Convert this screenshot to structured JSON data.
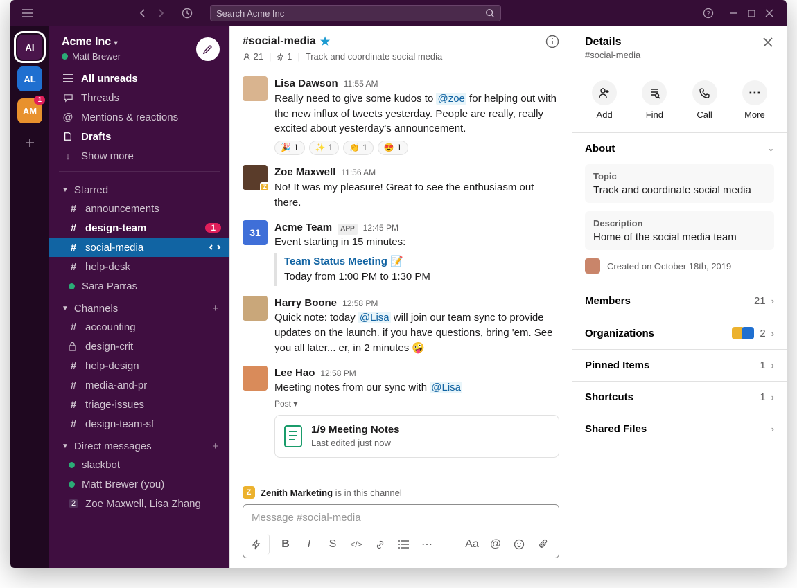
{
  "titlebar": {
    "search_placeholder": "Search Acme Inc"
  },
  "workspaces": [
    {
      "abbr": "AI",
      "color": "#4a154b"
    },
    {
      "abbr": "AL",
      "color": "#1f6fd0"
    },
    {
      "abbr": "AM",
      "color": "#e8912d",
      "badge": "1"
    }
  ],
  "sidebar": {
    "workspace": "Acme Inc",
    "user": "Matt Brewer",
    "nav": {
      "all_unreads": "All unreads",
      "threads": "Threads",
      "mentions": "Mentions & reactions",
      "drafts": "Drafts",
      "show_more": "Show more"
    },
    "starred_label": "Starred",
    "starred": [
      {
        "name": "announcements",
        "type": "hash"
      },
      {
        "name": "design-team",
        "type": "hash",
        "bold": true,
        "count": "1"
      },
      {
        "name": "social-media",
        "type": "hash",
        "active": true
      },
      {
        "name": "help-desk",
        "type": "hash"
      },
      {
        "name": "Sara Parras",
        "type": "dm",
        "presence": true
      }
    ],
    "channels_label": "Channels",
    "channels": [
      {
        "name": "accounting",
        "type": "hash"
      },
      {
        "name": "design-crit",
        "type": "lock"
      },
      {
        "name": "help-design",
        "type": "hash"
      },
      {
        "name": "media-and-pr",
        "type": "hash"
      },
      {
        "name": "triage-issues",
        "type": "hash"
      },
      {
        "name": "design-team-sf",
        "type": "hash"
      }
    ],
    "dms_label": "Direct messages",
    "dms": [
      {
        "name": "slackbot",
        "presence": true
      },
      {
        "name": "Matt Brewer (you)",
        "presence": true
      },
      {
        "name": "Zoe Maxwell, Lisa Zhang",
        "count_icon": "2"
      }
    ]
  },
  "channel_header": {
    "name": "#social-media",
    "members": "21",
    "pins": "1",
    "topic": "Track and coordinate social media"
  },
  "messages": [
    {
      "author": "Lisa Dawson",
      "time": "11:55 AM",
      "avatar_color": "#d9b48f",
      "text_pre": "Really need to give some kudos to ",
      "mention": "@zoe",
      "text_post": " for helping out with the new influx of tweets yesterday. People are really, really excited about yesterday's announcement.",
      "reactions": [
        {
          "emoji": "🎉",
          "count": "1"
        },
        {
          "emoji": "✨",
          "count": "1"
        },
        {
          "emoji": "👏",
          "count": "1"
        },
        {
          "emoji": "😍",
          "count": "1"
        }
      ]
    },
    {
      "author": "Zoe Maxwell",
      "time": "11:56 AM",
      "avatar_color": "#8b5a3c",
      "org_badge": "#ecb22e",
      "text": "No! It was my pleasure! Great to see the enthusiasm out there."
    },
    {
      "author": "Acme Team",
      "app": "APP",
      "time": "12:45 PM",
      "avatar_color": "#3f6fd8",
      "avatar_text": "31",
      "text": "Event starting in 15 minutes:",
      "event_title": "Team Status Meeting",
      "event_emoji": "📝",
      "event_sub": "Today from 1:00 PM to 1:30 PM"
    },
    {
      "author": "Harry Boone",
      "time": "12:58 PM",
      "avatar_color": "#c9a77a",
      "text_pre": "Quick note: today ",
      "mention": "@Lisa",
      "text_post": " will join our team sync to provide updates on the launch. if you have questions, bring 'em. See you all later... er, in 2 minutes 🤪"
    },
    {
      "author": "Lee Hao",
      "time": "12:58 PM",
      "avatar_color": "#d98b5a",
      "text_pre": "Meeting notes from our sync with ",
      "mention": "@Lisa",
      "post_label": "Post",
      "card_title": "1/9 Meeting Notes",
      "card_sub": "Last edited just now"
    }
  ],
  "banner": {
    "org": "Zenith Marketing",
    "suffix": "is in this channel"
  },
  "composer": {
    "placeholder": "Message #social-media"
  },
  "details": {
    "title": "Details",
    "channel": "#social-media",
    "actions": {
      "add": "Add",
      "find": "Find",
      "call": "Call",
      "more": "More"
    },
    "about_label": "About",
    "topic_label": "Topic",
    "topic": "Track and coordinate social media",
    "desc_label": "Description",
    "desc": "Home of the social media team",
    "created": "Created on October 18th, 2019",
    "members_label": "Members",
    "members_count": "21",
    "orgs_label": "Organizations",
    "orgs_count": "2",
    "pinned_label": "Pinned Items",
    "pinned_count": "1",
    "shortcuts_label": "Shortcuts",
    "shortcuts_count": "1",
    "files_label": "Shared Files"
  }
}
